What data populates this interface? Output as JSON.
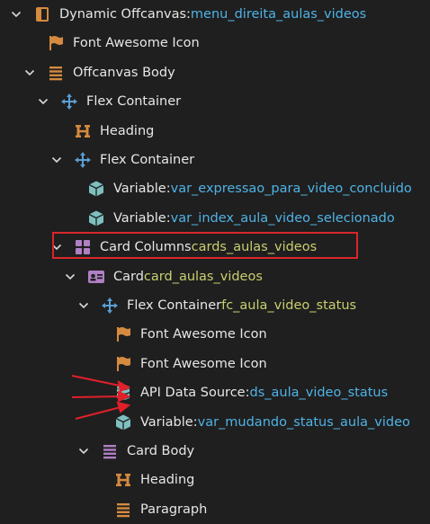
{
  "nodes": [
    {
      "depth": 0,
      "chev": true,
      "icon": "offcanvas-icon",
      "type": "Dynamic Offcanvas",
      "sep": ":",
      "name": "menu_direita_aulas_videos",
      "nameColor": "blue"
    },
    {
      "depth": 1,
      "chev": false,
      "icon": "flag-icon",
      "type": "Font Awesome Icon",
      "sep": "",
      "name": "",
      "nameColor": ""
    },
    {
      "depth": 1,
      "chev": true,
      "icon": "lines-icon",
      "type": "Offcanvas Body",
      "sep": "",
      "name": "",
      "nameColor": ""
    },
    {
      "depth": 2,
      "chev": true,
      "icon": "move-icon",
      "type": "Flex Container",
      "sep": "",
      "name": "",
      "nameColor": ""
    },
    {
      "depth": 3,
      "chev": false,
      "icon": "heading-icon",
      "type": "Heading",
      "sep": "",
      "name": "",
      "nameColor": ""
    },
    {
      "depth": 3,
      "chev": true,
      "icon": "move-icon",
      "type": "Flex Container",
      "sep": "",
      "name": "",
      "nameColor": ""
    },
    {
      "depth": 4,
      "chev": false,
      "icon": "cube-icon",
      "type": "Variable",
      "sep": ":",
      "name": "var_expressao_para_video_concluido",
      "nameColor": "blue"
    },
    {
      "depth": 4,
      "chev": false,
      "icon": "cube-icon",
      "type": "Variable",
      "sep": ":",
      "name": "var_index_aula_video_selecionado",
      "nameColor": "blue"
    },
    {
      "depth": 3,
      "chev": true,
      "icon": "grid-icon",
      "type": "Card Columns",
      "sep": "",
      "name": "cards_aulas_videos",
      "nameColor": "green"
    },
    {
      "depth": 4,
      "chev": true,
      "icon": "card-icon",
      "type": "Card",
      "sep": "",
      "name": "card_aulas_videos",
      "nameColor": "green"
    },
    {
      "depth": 5,
      "chev": true,
      "icon": "move-icon",
      "type": "Flex Container",
      "sep": "",
      "name": "fc_aula_video_status",
      "nameColor": "green"
    },
    {
      "depth": 6,
      "chev": false,
      "icon": "flag-icon",
      "type": "Font Awesome Icon",
      "sep": "",
      "name": "",
      "nameColor": ""
    },
    {
      "depth": 6,
      "chev": false,
      "icon": "flag-icon",
      "type": "Font Awesome Icon",
      "sep": "",
      "name": "",
      "nameColor": ""
    },
    {
      "depth": 6,
      "chev": false,
      "icon": "database-icon",
      "type": "API Data Source",
      "sep": ":",
      "name": "ds_aula_video_status",
      "nameColor": "blue"
    },
    {
      "depth": 6,
      "chev": false,
      "icon": "cube-icon",
      "type": "Variable",
      "sep": ":",
      "name": "var_mudando_status_aula_video",
      "nameColor": "blue"
    },
    {
      "depth": 5,
      "chev": true,
      "icon": "lines-purple-icon",
      "type": "Card Body",
      "sep": "",
      "name": "",
      "nameColor": ""
    },
    {
      "depth": 6,
      "chev": false,
      "icon": "heading-icon",
      "type": "Heading",
      "sep": "",
      "name": "",
      "nameColor": ""
    },
    {
      "depth": 6,
      "chev": false,
      "icon": "lines-icon",
      "type": "Paragraph",
      "sep": "",
      "name": "",
      "nameColor": ""
    }
  ],
  "colors": {
    "background": "#1f1f1f",
    "text": "#e6e6e6",
    "name_blue": "#4fb3e6",
    "name_green": "#c9cf6f",
    "orange_icon": "#d58a3f",
    "teal_icon": "#7fbfbf",
    "purple_icon": "#b07fc4",
    "blue_icon": "#5a9fd4",
    "highlight_border": "#d9262b",
    "arrow": "#e0202a"
  }
}
